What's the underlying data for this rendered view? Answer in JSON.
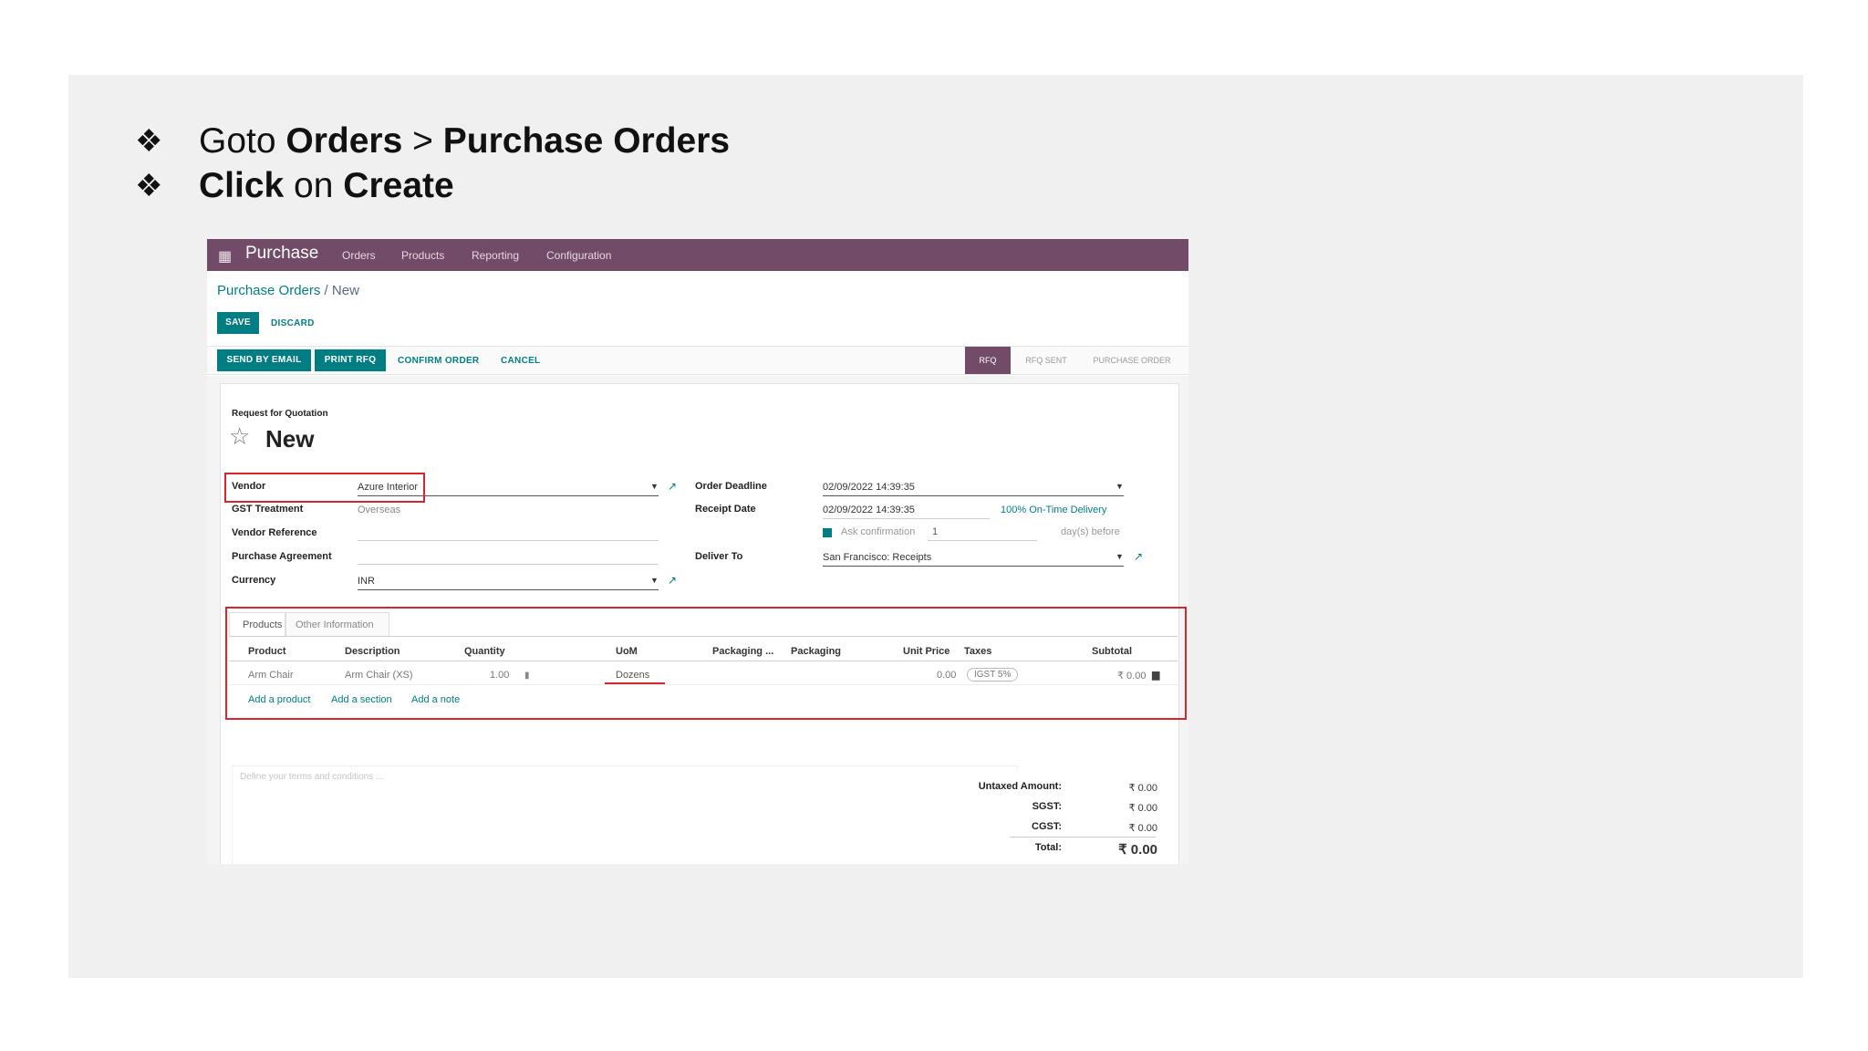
{
  "bullets": [
    {
      "pre": "Goto ",
      "b1": "Orders",
      "mid": " > ",
      "b2": "Purchase Orders"
    },
    {
      "pre": "",
      "b1": "Click",
      "mid": " on ",
      "b2": "Create"
    }
  ],
  "bullet_symbol": "❖",
  "app": {
    "name": "Purchase",
    "menu": [
      "Orders",
      "Products",
      "Reporting",
      "Configuration"
    ],
    "brand_color": "#714b67",
    "accent_color": "#017e84"
  },
  "breadcrumb": {
    "parent": "Purchase Orders",
    "sep": " / ",
    "current": "New"
  },
  "actions": {
    "save": "SAVE",
    "discard": "DISCARD"
  },
  "workflow": {
    "send_email": "SEND BY EMAIL",
    "print_rfq": "PRINT RFQ",
    "confirm": "CONFIRM ORDER",
    "cancel": "CANCEL",
    "stages": [
      "RFQ",
      "RFQ SENT",
      "PURCHASE ORDER"
    ],
    "active_stage": "RFQ"
  },
  "form": {
    "subtitle": "Request for Quotation",
    "title": "New",
    "vendor_label": "Vendor",
    "vendor_value": "Azure Interior",
    "gst_label": "GST Treatment",
    "gst_value": "Overseas",
    "vendor_ref_label": "Vendor Reference",
    "agreement_label": "Purchase Agreement",
    "currency_label": "Currency",
    "currency_value": "INR",
    "deadline_label": "Order Deadline",
    "deadline_value": "02/09/2022 14:39:35",
    "receipt_label": "Receipt Date",
    "receipt_value": "02/09/2022 14:39:35",
    "on_time": "100% On-Time Delivery",
    "ask_confirm": "Ask confirmation",
    "ask_days": "1",
    "days_before": "day(s) before",
    "deliver_label": "Deliver To",
    "deliver_value": "San Francisco: Receipts"
  },
  "tabs": [
    "Products",
    "Other Information"
  ],
  "lines": {
    "headers": [
      "Product",
      "Description",
      "Quantity",
      "UoM",
      "Packaging ...",
      "Packaging",
      "Unit Price",
      "Taxes",
      "Subtotal"
    ],
    "rows": [
      {
        "product": "Arm Chair",
        "description": "Arm Chair (XS)",
        "quantity": "1.00",
        "uom": "Dozens",
        "unit_price": "0.00",
        "taxes": "IGST 5%",
        "subtotal": "₹ 0.00"
      }
    ],
    "add_product": "Add a product",
    "add_section": "Add a section",
    "add_note": "Add a note"
  },
  "terms_placeholder": "Define your terms and conditions ...",
  "totals": [
    {
      "label": "Untaxed Amount:",
      "value": "₹ 0.00"
    },
    {
      "label": "SGST:",
      "value": "₹ 0.00"
    },
    {
      "label": "CGST:",
      "value": "₹ 0.00"
    },
    {
      "label": "Total:",
      "value": "₹ 0.00"
    }
  ]
}
